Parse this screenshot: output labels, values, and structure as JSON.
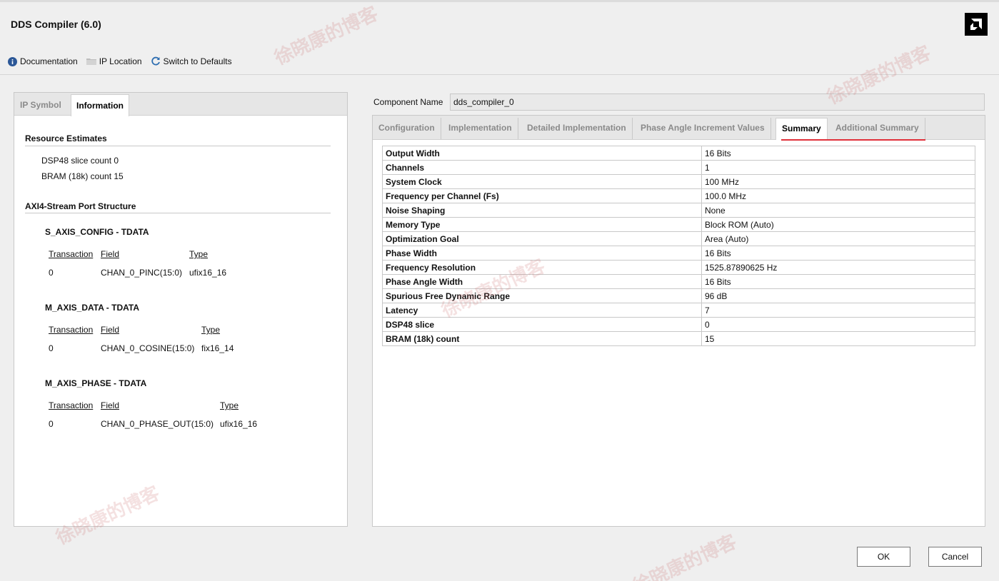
{
  "window": {
    "title": "DDS Compiler (6.0)"
  },
  "toolbar": {
    "documentation": "Documentation",
    "ip_location": "IP Location",
    "switch_defaults": "Switch to Defaults"
  },
  "left_tabs": [
    "IP Symbol",
    "Information"
  ],
  "info": {
    "resource_title": "Resource Estimates",
    "dsp": "DSP48 slice count 0",
    "bram": "BRAM (18k) count 15",
    "axi_title": "AXI4-Stream Port Structure",
    "col_transaction": "Transaction",
    "col_field": "Field",
    "col_type": "Type",
    "ports": [
      {
        "name": "S_AXIS_CONFIG - TDATA",
        "transaction": "0",
        "field": "CHAN_0_PINC(15:0)",
        "type": "ufix16_16"
      },
      {
        "name": "M_AXIS_DATA - TDATA",
        "transaction": "0",
        "field": "CHAN_0_COSINE(15:0)",
        "type": "fix16_14"
      },
      {
        "name": "M_AXIS_PHASE - TDATA",
        "transaction": "0",
        "field": "CHAN_0_PHASE_OUT(15:0)",
        "type": "ufix16_16"
      }
    ]
  },
  "component": {
    "label": "Component Name",
    "value": "dds_compiler_0"
  },
  "right_tabs": [
    "Configuration",
    "Implementation",
    "Detailed Implementation",
    "Phase Angle Increment Values",
    "Summary",
    "Additional Summary"
  ],
  "summary_rows": [
    [
      "Output Width",
      "16 Bits"
    ],
    [
      "Channels",
      "1"
    ],
    [
      "System Clock",
      "100 MHz"
    ],
    [
      "Frequency per Channel (Fs)",
      "100.0 MHz"
    ],
    [
      "Noise Shaping",
      "None"
    ],
    [
      "Memory Type",
      "Block ROM (Auto)"
    ],
    [
      "Optimization Goal",
      "Area (Auto)"
    ],
    [
      "Phase Width",
      "16 Bits"
    ],
    [
      "Frequency Resolution",
      "1525.87890625 Hz"
    ],
    [
      "Phase Angle Width",
      "16 Bits"
    ],
    [
      "Spurious Free Dynamic Range",
      "96 dB"
    ],
    [
      "Latency",
      "7"
    ],
    [
      "DSP48 slice",
      "0"
    ],
    [
      "BRAM (18k) count",
      "15"
    ]
  ],
  "buttons": {
    "ok": "OK",
    "cancel": "Cancel"
  },
  "watermark": "徐晓康的博客",
  "colors": {
    "accent_underline": "#e0303a",
    "info_icon": "#2b5797",
    "refresh_icon": "#2b6cb0"
  }
}
